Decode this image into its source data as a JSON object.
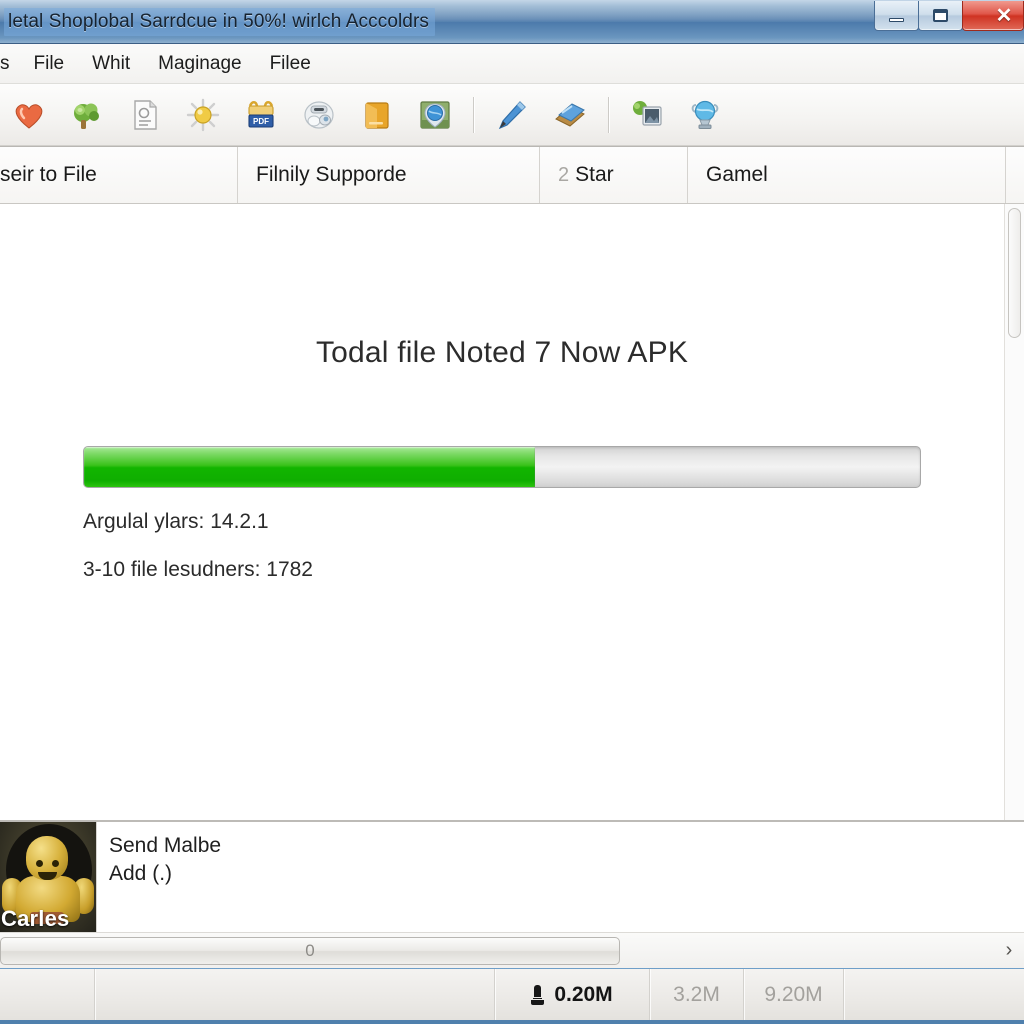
{
  "window": {
    "title": "letal Shoplobal Sarrdcue in 50%! wirlch Acccoldrs",
    "controls": {
      "minimize": "minimize",
      "maximize": "maximize",
      "close": "✕"
    }
  },
  "menubar": {
    "items": [
      {
        "label": "s"
      },
      {
        "label": "File"
      },
      {
        "label": "Whit"
      },
      {
        "label": "Maginage"
      },
      {
        "label": "Filee"
      }
    ]
  },
  "toolbar": {
    "group1": [
      {
        "name": "heart-icon",
        "color": "#e8603c"
      },
      {
        "name": "tree-icon",
        "color": "#6eaa3a"
      },
      {
        "name": "document-icon",
        "color": "#b9b9b9"
      },
      {
        "name": "sun-burst-icon",
        "color": "#e8c23c"
      },
      {
        "name": "folder-pdf-icon",
        "color": "#e0ae35"
      },
      {
        "name": "robot-icon",
        "color": "#d8dce0"
      },
      {
        "name": "book-orange-icon",
        "color": "#e3a52c"
      },
      {
        "name": "globe-map-icon",
        "color": "#3d8fd0"
      }
    ],
    "group2": [
      {
        "name": "pencil-icon",
        "color": "#3a7fc4"
      },
      {
        "name": "notebook-icon",
        "color": "#4f93cd"
      }
    ],
    "group3": [
      {
        "name": "photo-tree-icon",
        "color": "#5c8f4a"
      },
      {
        "name": "globe-trophy-icon",
        "color": "#56aedd"
      }
    ]
  },
  "tabs": [
    {
      "label": "seir to File",
      "num": ""
    },
    {
      "label": "Filnily Supporde",
      "num": ""
    },
    {
      "label": "Star",
      "num": "2"
    },
    {
      "label": "Gamel",
      "num": ""
    }
  ],
  "main": {
    "heading": "Todal file Noted 7 Now APK",
    "progress": {
      "percent": 54,
      "fill_color": "#12b500",
      "track_color": "#e6e6e6"
    },
    "stats": [
      {
        "label": "Argulal ylars: 14.2.1"
      },
      {
        "label": "3-10 file lesudners: 1782"
      }
    ]
  },
  "attachment": {
    "thumbnail_caption": "Carles",
    "lines": [
      {
        "text": "Send Malbe"
      },
      {
        "text": "Add (.)"
      }
    ]
  },
  "hscroll": {
    "grip": "0",
    "arrow": "›"
  },
  "statusbar": {
    "download_value": "0.20M",
    "secondary_value": "3.2M",
    "tertiary_value": "9.20M",
    "blank1": "",
    "blank2": "",
    "blank3": ""
  }
}
